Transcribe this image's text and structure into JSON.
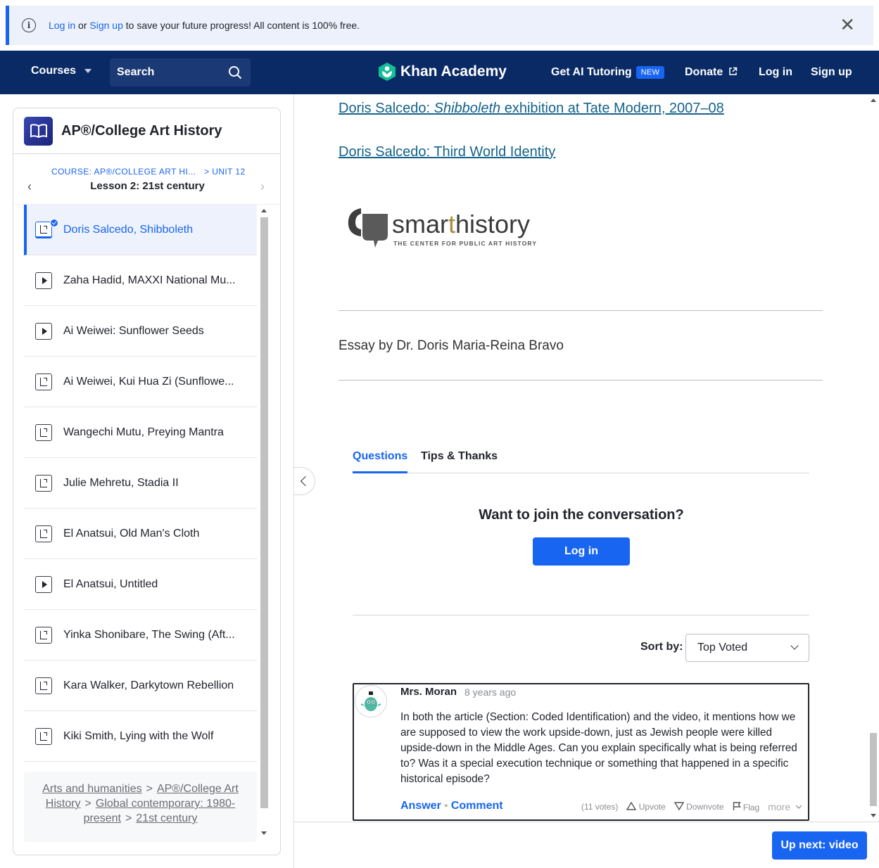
{
  "banner": {
    "login": "Log in",
    "or": "or",
    "signup": "Sign up",
    "rest": "to save your future progress! All content is 100% free.",
    "close_icon": "close-icon"
  },
  "nav": {
    "courses": "Courses",
    "search": "Search",
    "logo": "Khan Academy",
    "tutoring": "Get AI Tutoring",
    "tutoring_badge": "NEW",
    "donate": "Donate",
    "login": "Log in",
    "signup": "Sign up"
  },
  "sidebar": {
    "course_title": "AP®/College Art History",
    "crumb_course": "COURSE: AP®/COLLEGE ART HI...",
    "crumb_unit": "> UNIT 12",
    "lesson": "Lesson 2: 21st century",
    "items": [
      {
        "label": "Doris Salcedo, Shibboleth",
        "type": "article",
        "active": true
      },
      {
        "label": "Zaha Hadid, MAXXI National Mu...",
        "type": "video"
      },
      {
        "label": "Ai Weiwei: Sunflower Seeds",
        "type": "video"
      },
      {
        "label": "Ai Weiwei, Kui Hua Zi (Sunflowe...",
        "type": "article"
      },
      {
        "label": "Wangechi Mutu, Preying Mantra",
        "type": "article"
      },
      {
        "label": "Julie Mehretu, Stadia II",
        "type": "article"
      },
      {
        "label": "El Anatsui, Old Man's Cloth",
        "type": "article"
      },
      {
        "label": "El Anatsui, Untitled",
        "type": "video"
      },
      {
        "label": "Yinka Shonibare, The Swing (Aft...",
        "type": "article"
      },
      {
        "label": "Kara Walker, Darkytown Rebellion",
        "type": "article"
      },
      {
        "label": "Kiki Smith, Lying with the Wolf",
        "type": "article"
      }
    ],
    "breadcrumb": {
      "b1": "Arts and humanities",
      "b2": "AP®/College Art History",
      "b3": "Global contemporary: 1980-present",
      "b4": "21st century",
      "sep": ">"
    }
  },
  "main": {
    "link1_pre": "Doris Salcedo: ",
    "link1_em": "Shibboleth",
    "link1_post": " exhibition at Tate Modern, 2007–08",
    "link2": "Doris Salcedo: Third World Identity",
    "logo_word_1": "smar",
    "logo_word_2": "t",
    "logo_word_3": "history",
    "logo_tag": "THE CENTER FOR PUBLIC ART HISTORY",
    "essay_by": "Essay by Dr. Doris Maria-Reina Bravo",
    "tab_questions": "Questions",
    "tab_tips": "Tips & Thanks",
    "join_prompt": "Want to join the conversation?",
    "login_button": "Log in",
    "sort_label": "Sort by:",
    "sort_value": "Top Voted"
  },
  "comment": {
    "author": "Mrs. Moran",
    "age": "8 years ago",
    "body": "In both the article (Section: Coded Identification) and the video, it mentions how we are supposed to view the work upside-down, just as Jewish people were killed upside-down in the Middle Ages. Can you explain specifically what is being referred to? Was it a special execution technique or something that happened in a specific historical episode?",
    "answer": "Answer",
    "comment": "Comment",
    "votes": "(11 votes)",
    "upvote": "Upvote",
    "downvote": "Downvote",
    "flag": "Flag",
    "more": "more"
  },
  "footer": {
    "up_next": "Up next: video"
  },
  "colors": {
    "nav_bg": "#0a2a66",
    "accent": "#1865f2",
    "banner_bg": "#edf1fb",
    "logo_green": "#14bf96"
  }
}
